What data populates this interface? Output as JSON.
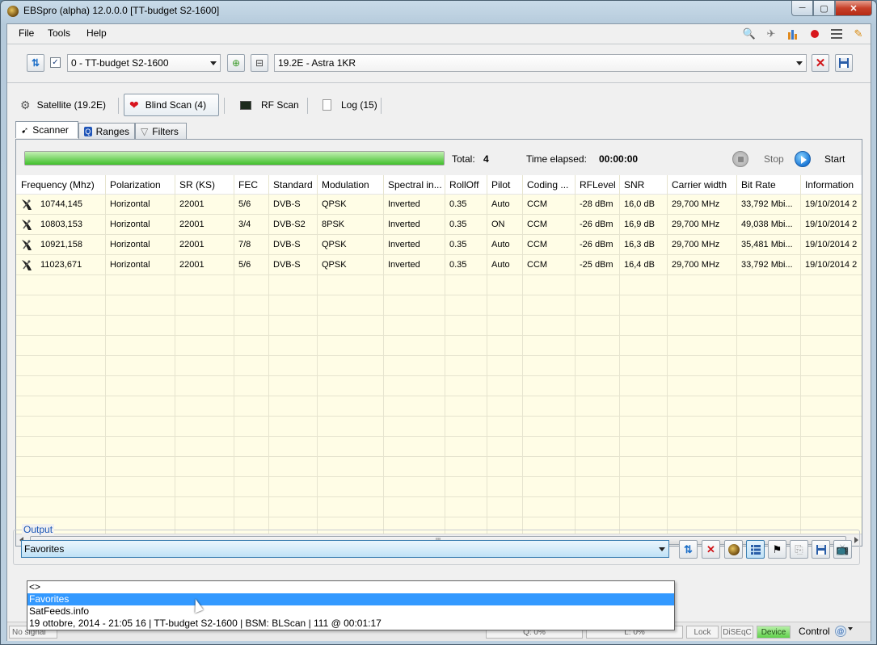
{
  "window": {
    "title": "EBSpro (alpha) 12.0.0.0 [TT-budget S2-1600]",
    "controls": [
      "─",
      "▢",
      "✕"
    ]
  },
  "menu": {
    "items": [
      "File",
      "Tools",
      "Help"
    ]
  },
  "top_icons": [
    "search-icon",
    "satellite-icon",
    "chart-icon",
    "record-icon",
    "list-icon",
    "edit-icon"
  ],
  "toolbar": {
    "device_checked": true,
    "device_select": "0 - TT-budget S2-1600",
    "satellite_select": "19.2E - Astra 1KR"
  },
  "main_tabs": [
    {
      "label": "Satellite (19.2E)",
      "icon": "satellite-dish-icon",
      "active": false
    },
    {
      "label": "Blind Scan (4)",
      "icon": "heart-icon",
      "active": true
    },
    {
      "label": "RF Scan",
      "icon": "monitor-icon",
      "active": false
    },
    {
      "label": "Log (15)",
      "icon": "document-icon",
      "active": false
    }
  ],
  "sub_tabs": [
    {
      "label": "Scanner",
      "icon": "scanner-icon",
      "active": true
    },
    {
      "label": "Ranges",
      "icon": "magnifier-icon",
      "active": false
    },
    {
      "label": "Filters",
      "icon": "funnel-icon",
      "active": false
    }
  ],
  "scan": {
    "progress": 1.0,
    "total_label": "Total:",
    "total_value": "4",
    "elapsed_label": "Time elapsed:",
    "elapsed_value": "00:00:00",
    "stop_label": "Stop",
    "start_label": "Start"
  },
  "table": {
    "columns": [
      "Frequency (Mhz)",
      "Polarization",
      "SR (KS)",
      "FEC",
      "Standard",
      "Modulation",
      "Spectral in...",
      "RollOff",
      "Pilot",
      "Coding ...",
      "RFLevel",
      "SNR",
      "Carrier width",
      "Bit Rate",
      "Information"
    ],
    "rows": [
      [
        "10744,145",
        "Horizontal",
        "22001",
        "5/6",
        "DVB-S",
        "QPSK",
        "Inverted",
        "0.35",
        "Auto",
        "CCM",
        "-28 dBm",
        "16,0 dB",
        "29,700 MHz",
        "33,792 Mbi...",
        "19/10/2014 2"
      ],
      [
        "10803,153",
        "Horizontal",
        "22001",
        "3/4",
        "DVB-S2",
        "8PSK",
        "Inverted",
        "0.35",
        "ON",
        "CCM",
        "-26 dBm",
        "16,9 dB",
        "29,700 MHz",
        "49,038 Mbi...",
        "19/10/2014 2"
      ],
      [
        "10921,158",
        "Horizontal",
        "22001",
        "7/8",
        "DVB-S",
        "QPSK",
        "Inverted",
        "0.35",
        "Auto",
        "CCM",
        "-26 dBm",
        "16,3 dB",
        "29,700 MHz",
        "35,481 Mbi...",
        "19/10/2014 2"
      ],
      [
        "11023,671",
        "Horizontal",
        "22001",
        "5/6",
        "DVB-S",
        "QPSK",
        "Inverted",
        "0.35",
        "Auto",
        "CCM",
        "-25 dBm",
        "16,4 dB",
        "29,700 MHz",
        "33,792 Mbi...",
        "19/10/2014 2"
      ]
    ]
  },
  "output": {
    "label": "Output",
    "selected": "Favorites",
    "options": [
      "<>",
      "Favorites",
      "SatFeeds.info",
      "19 ottobre, 2014 - 21:05 16 | TT-budget S2-1600 | BSM: BLScan | 111 @ 00:01:17"
    ],
    "highlighted_index": 1
  },
  "status": {
    "signal": "No signal",
    "q": "Q: 0%",
    "l": "L: 0%",
    "lock": "Lock",
    "diseqc": "DiSEqC",
    "device": "Device",
    "control": "Control"
  },
  "colors": {
    "grid_bg": "#fffde6",
    "selection": "#3399ff",
    "progress_fill": "#3fbf2a",
    "output_label": "#1a56b6"
  }
}
